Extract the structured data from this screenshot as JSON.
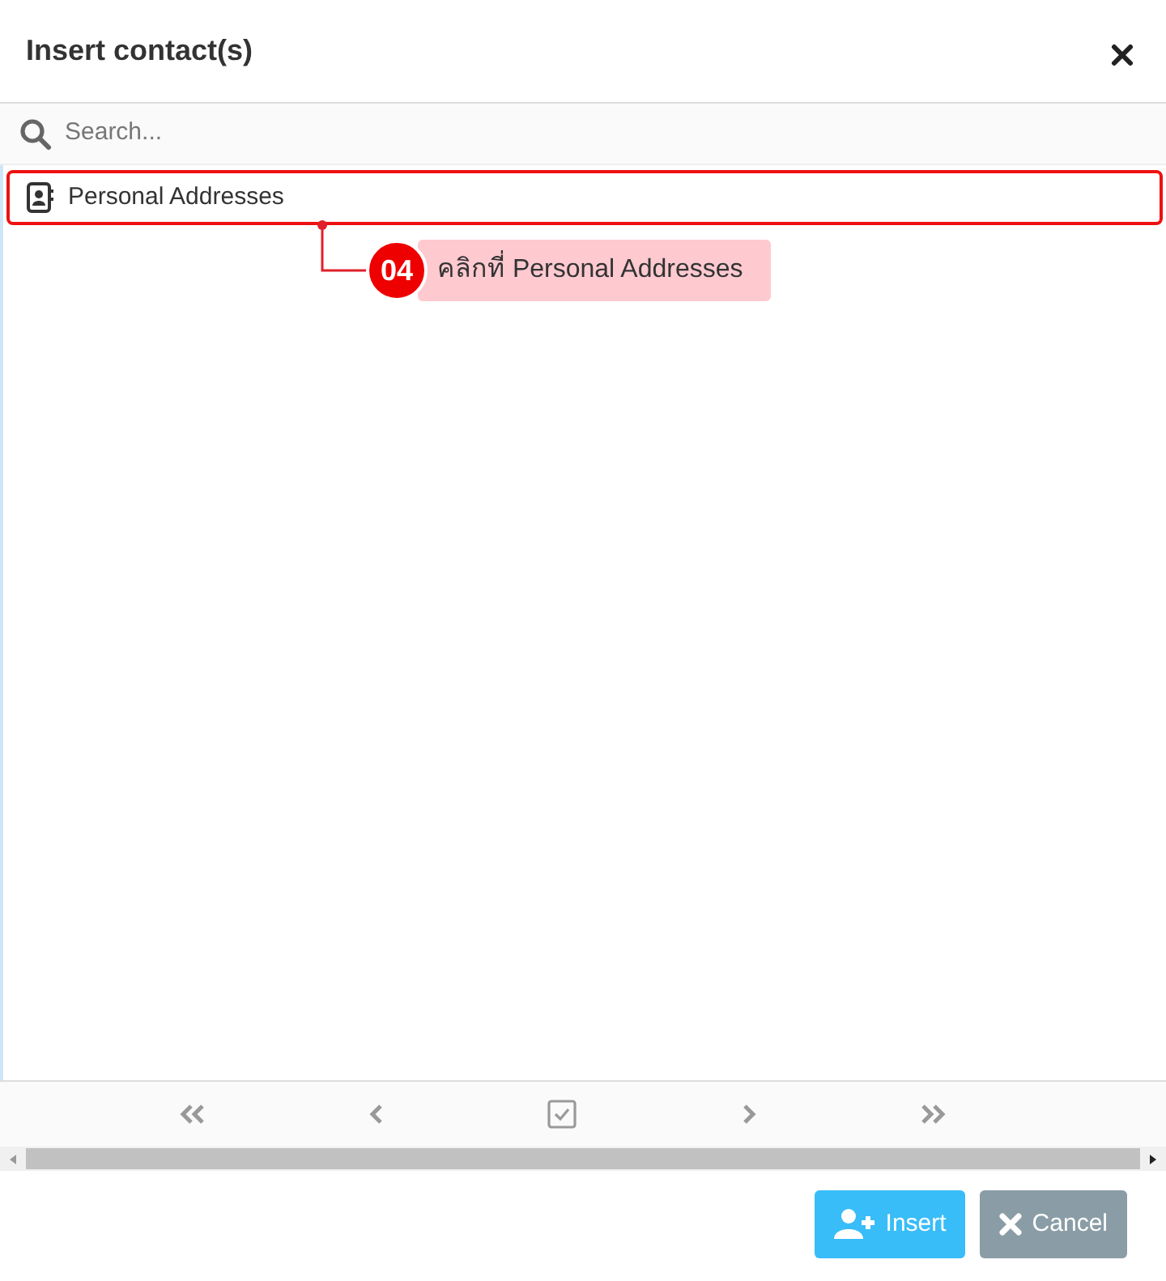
{
  "dialog": {
    "title": "Insert contact(s)"
  },
  "search": {
    "placeholder": "Search..."
  },
  "list": {
    "items": [
      {
        "label": "Personal Addresses",
        "highlighted": true
      }
    ]
  },
  "callout": {
    "number": "04",
    "text": "คลิกที่ Personal Addresses"
  },
  "buttons": [
    {
      "kind": "insert",
      "label": "Insert"
    },
    {
      "kind": "cancel",
      "label": "Cancel"
    }
  ]
}
